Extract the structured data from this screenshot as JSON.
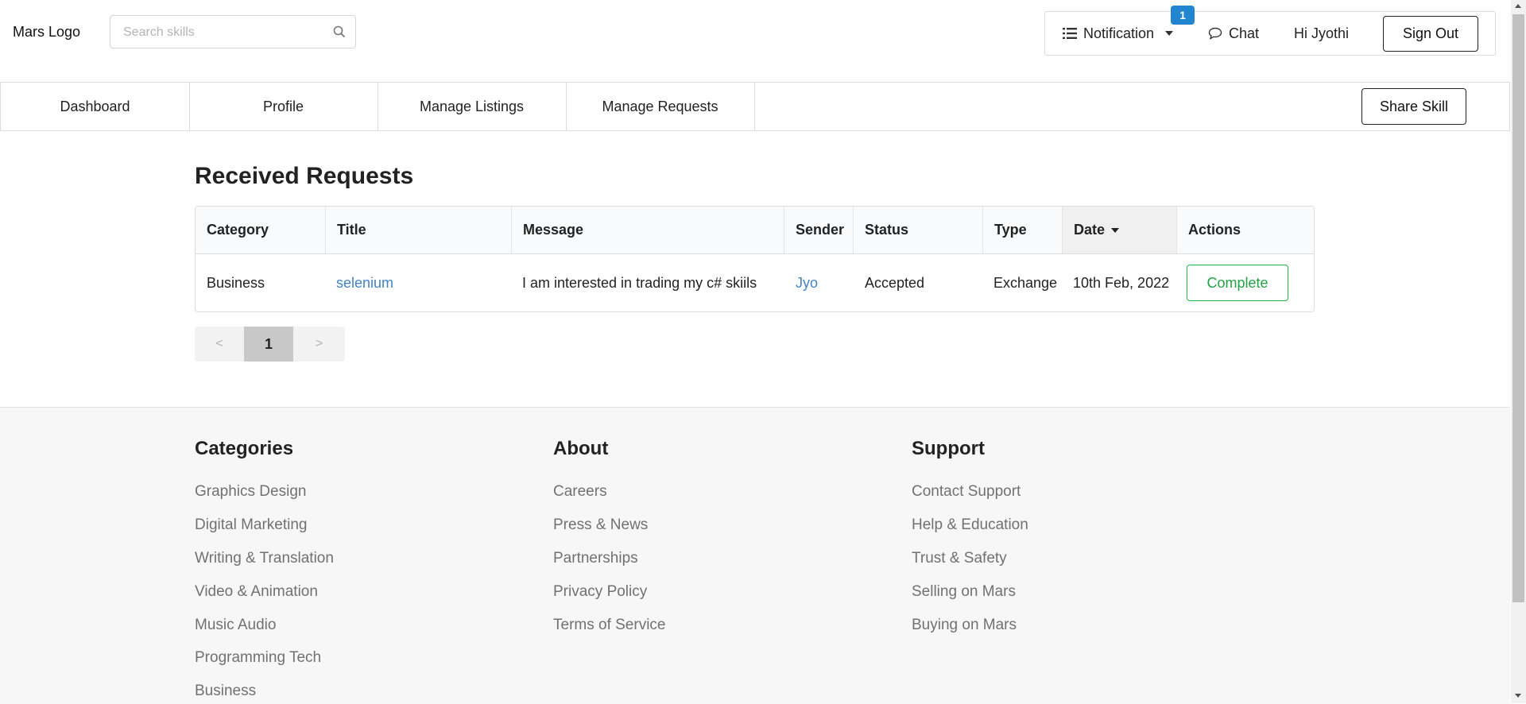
{
  "header": {
    "logo": "Mars Logo",
    "search_placeholder": "Search skills",
    "search_icon": "search-icon",
    "notification_label": "Notification",
    "notification_badge": "1",
    "chat_label": "Chat",
    "greeting": "Hi Jyothi",
    "signout_label": "Sign Out"
  },
  "nav": {
    "tabs": [
      {
        "label": "Dashboard"
      },
      {
        "label": "Profile"
      },
      {
        "label": "Manage Listings"
      },
      {
        "label": "Manage Requests"
      }
    ],
    "share_label": "Share Skill"
  },
  "main": {
    "title": "Received Requests",
    "columns": [
      "Category",
      "Title",
      "Message",
      "Sender",
      "Status",
      "Type",
      "Date",
      "Actions"
    ],
    "sorted_column": "Date",
    "rows": [
      {
        "category": "Business",
        "title": "selenium",
        "message": "I am interested in trading my c# skiils",
        "sender": "Jyo",
        "status": "Accepted",
        "type": "Exchange",
        "date": "10th Feb, 2022",
        "action": "Complete"
      }
    ],
    "pagination": {
      "prev": "<",
      "current": "1",
      "next": ">"
    }
  },
  "footer": {
    "categories": {
      "title": "Categories",
      "links": [
        "Graphics Design",
        "Digital Marketing",
        "Writing & Translation",
        "Video & Animation",
        "Music Audio",
        "Programming Tech",
        "Business"
      ]
    },
    "about": {
      "title": "About",
      "links": [
        "Careers",
        "Press & News",
        "Partnerships",
        "Privacy Policy",
        "Terms of Service"
      ]
    },
    "support": {
      "title": "Support",
      "links": [
        "Contact Support",
        "Help & Education",
        "Trust & Safety",
        "Selling on Mars",
        "Buying on Mars"
      ]
    }
  },
  "colors": {
    "link": "#4183c4",
    "badge": "#2185d0",
    "complete": "#21ba45"
  }
}
